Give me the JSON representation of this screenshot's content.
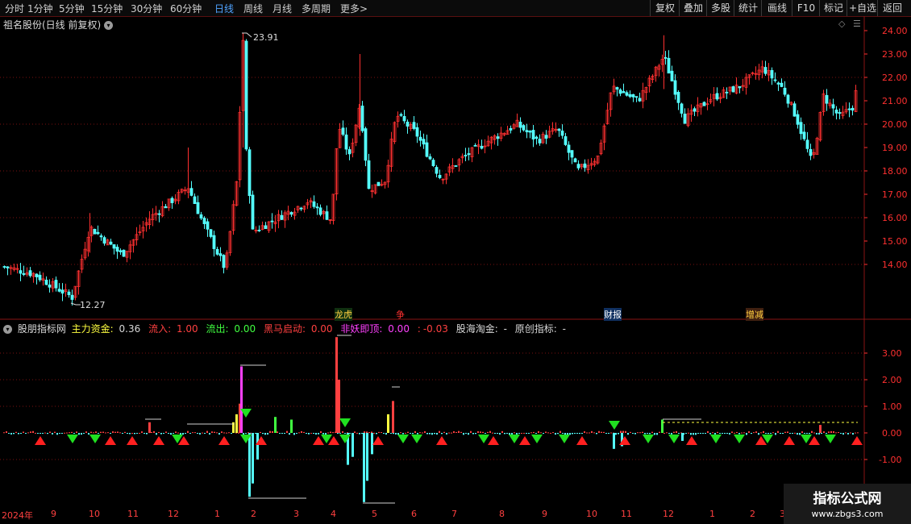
{
  "toolbar": {
    "periods": [
      "分时",
      "1分钟",
      "5分钟",
      "15分钟",
      "30分钟",
      "60分钟",
      "日线",
      "周线",
      "月线",
      "多周期",
      "更多"
    ],
    "active": "日线",
    "more_arrow": ">",
    "buttons": [
      "复权",
      "叠加",
      "多股",
      "统计",
      "画线",
      "F10",
      "标记",
      "+自选",
      "返回"
    ]
  },
  "price_panel": {
    "title": "祖名股份(日线 前复权)",
    "high_label": "23.91",
    "low_label": "12.27",
    "events": [
      "龙虎",
      "争",
      "财报",
      "增减"
    ],
    "y_ticks": [
      "24.00",
      "23.00",
      "22.00",
      "21.00",
      "20.00",
      "19.00",
      "18.00",
      "17.00",
      "16.00",
      "15.00",
      "14.00"
    ]
  },
  "indicator_panel": {
    "name": "股朋指标网",
    "items": [
      {
        "label": "主力资金:",
        "value": "0.36",
        "color": "#ffff40"
      },
      {
        "label": "流入:",
        "value": "1.00",
        "color": "#ff4040"
      },
      {
        "label": "流出:",
        "value": "0.00",
        "color": "#40ff40"
      },
      {
        "label": "黑马启动:",
        "value": "0.00",
        "color": "#ff4040"
      },
      {
        "label": "非妖即顶:",
        "value": "0.00",
        "color": "#ff40ff"
      },
      {
        "label": ":",
        "value": "-0.03",
        "color": "#ff4040"
      },
      {
        "label": "股海淘金:",
        "value": "-",
        "color": "#d8d8d8"
      },
      {
        "label": "原创指标:",
        "value": "-",
        "color": "#d8d8d8"
      }
    ],
    "y_ticks": [
      "3.00",
      "2.00",
      "1.00",
      "0.00",
      "-1.00"
    ]
  },
  "date_axis": [
    "2024年",
    "9",
    "10",
    "11",
    "12",
    "1",
    "2",
    "3",
    "4",
    "5",
    "6",
    "7",
    "8",
    "9",
    "10",
    "11",
    "12",
    "1",
    "2",
    "3"
  ],
  "watermark": {
    "line1": "指标公式网",
    "line2": "www.zbgs3.com"
  },
  "colors": {
    "up": "#ff3030",
    "down": "#54ffff",
    "grid": "#7a1010",
    "accent": "#4fa3ff"
  }
}
